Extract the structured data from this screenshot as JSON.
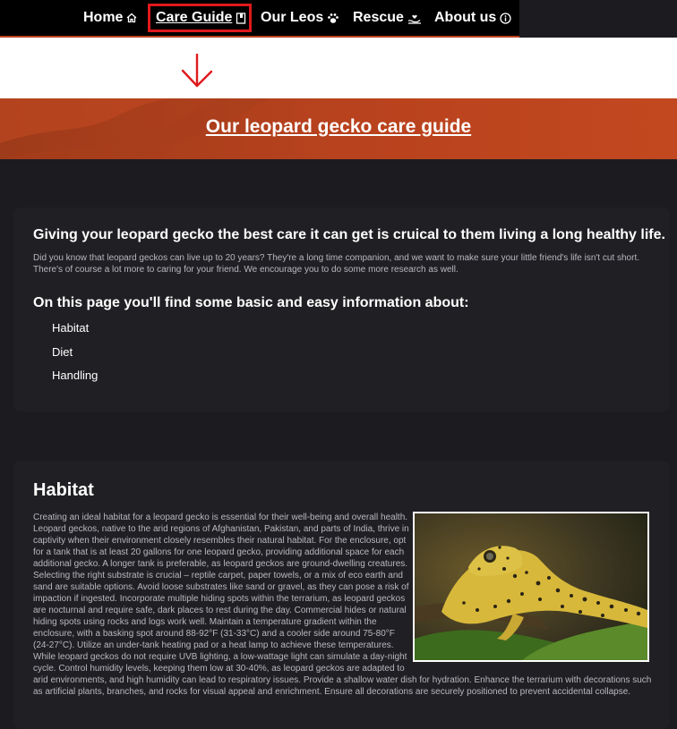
{
  "nav": {
    "items": [
      {
        "label": "Home",
        "icon": "home-icon"
      },
      {
        "label": "Care Guide",
        "icon": "book-icon",
        "active": true
      },
      {
        "label": "Our Leos",
        "icon": "paw-icon"
      },
      {
        "label": "Rescue",
        "icon": "hand-heart-icon"
      },
      {
        "label": "About us",
        "icon": "info-icon"
      }
    ],
    "active_color": "#e0191c"
  },
  "banner": {
    "title": "Our leopard gecko care guide",
    "color": "#b8421e"
  },
  "intro": {
    "heading": "Giving your leopard gecko the best care it can get is cruical to them living a long healthy life.",
    "text": "Did you know that leopard geckos can live up to 20 years? They're a long time companion, and we want to make sure your little friend's life isn't cut short. There's of course a lot more to caring for your friend. We encourage you to do some more research as well.",
    "list_heading": "On this page you'll find some basic and easy information about:",
    "topics": [
      "Habitat",
      "Diet",
      "Handling"
    ]
  },
  "habitat": {
    "heading": "Habitat",
    "text": "Creating an ideal habitat for a leopard gecko is essential for their well-being and overall health. Leopard geckos, native to the arid regions of Afghanistan, Pakistan, and parts of India, thrive in captivity when their environment closely resembles their natural habitat. For the enclosure, opt for a tank that is at least 20 gallons for one leopard gecko, providing additional space for each additional gecko. A longer tank is preferable, as leopard geckos are ground-dwelling creatures. Selecting the right substrate is crucial – reptile carpet, paper towels, or a mix of eco earth and sand are suitable options. Avoid loose substrates like sand or gravel, as they can pose a risk of impaction if ingested. Incorporate multiple hiding spots within the terrarium, as leopard geckos are nocturnal and require safe, dark places to rest during the day. Commercial hides or natural hiding spots using rocks and logs work well. Maintain a temperature gradient within the enclosure, with a basking spot around 88-92°F (31-33°C) and a cooler side around 75-80°F (24-27°C). Utilize an under-tank heating pad or a heat lamp to achieve these temperatures. While leopard geckos do not require UVB lighting, a low-wattage light can simulate a day-night cycle. Control humidity levels, keeping them low at 30-40%, as leopard geckos are adapted to arid environments, and high humidity can lead to respiratory issues. Provide a shallow water dish for hydration. Enhance the terrarium with decorations such as artificial plants, branches, and rocks for visual appeal and enrichment. Ensure all decorations are securely positioned to prevent accidental collapse."
  }
}
